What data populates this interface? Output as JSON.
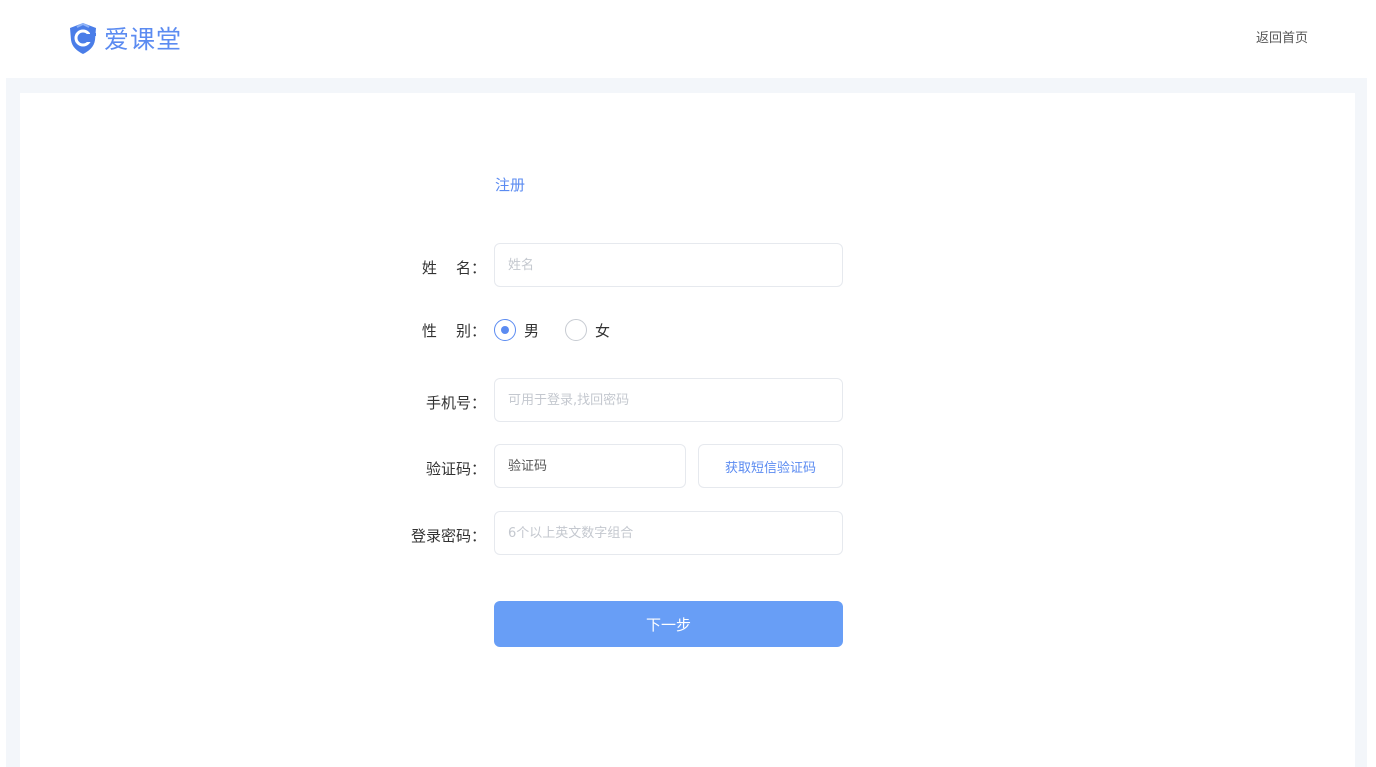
{
  "header": {
    "brand_name": "爱课堂",
    "home_link": "返回首页",
    "logo_icon": "shield-logo-icon"
  },
  "form": {
    "title": "注册",
    "name": {
      "label": "姓    名：",
      "placeholder": "姓名"
    },
    "gender": {
      "label": "性    别：",
      "options": [
        {
          "label": "男",
          "checked": true
        },
        {
          "label": "女",
          "checked": false
        }
      ]
    },
    "phone": {
      "label": "手机号：",
      "placeholder": "可用于登录,找回密码"
    },
    "code": {
      "label": "验证码：",
      "placeholder": "验证码",
      "sms_button": "获取短信验证码"
    },
    "password": {
      "label": "登录密码：",
      "placeholder": "6个以上英文数字组合"
    },
    "next_button": "下一步"
  },
  "colors": {
    "accent": "#5b8bf1",
    "button": "#689ef6",
    "backdrop": "#f3f6fa"
  }
}
